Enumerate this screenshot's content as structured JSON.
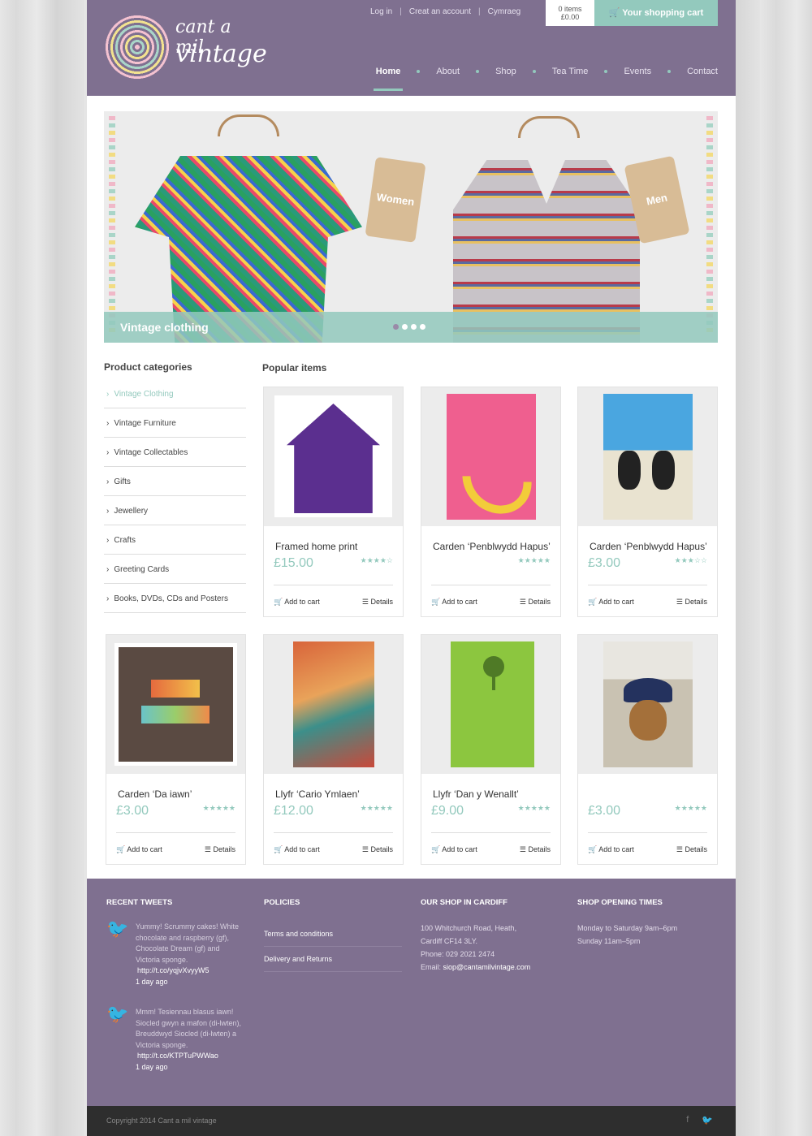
{
  "header": {
    "logo_line1": "cant a mil",
    "logo_line2": "vintage",
    "top_links": [
      "Log in",
      "Creat an account",
      "Cymraeg"
    ],
    "cart_items": "0 items",
    "cart_total": "£0.00",
    "cart_button": "Your shopping cart",
    "nav": [
      "Home",
      "About",
      "Shop",
      "Tea Time",
      "Events",
      "Contact"
    ]
  },
  "slider": {
    "tag_women": "Women",
    "tag_men": "Men",
    "caption": "Vintage clothing",
    "slide_count": 4,
    "active_slide": 1
  },
  "sidebar": {
    "title": "Product categories",
    "categories": [
      "Vintage Clothing",
      "Vintage Furniture",
      "Vintage Collectables",
      "Gifts",
      "Jewellery",
      "Crafts",
      "Greeting Cards",
      "Books, DVDs, CDs and Posters"
    ]
  },
  "popular": {
    "title": "Popular items",
    "add_label": "Add to cart",
    "details_label": "Details",
    "products": [
      {
        "name": "Framed home print",
        "price": "£15.00",
        "rating": 4
      },
      {
        "name": "Carden ‘Penblwydd Hapus’",
        "price": "",
        "rating": 5
      },
      {
        "name": "Carden ‘Penblwydd Hapus’",
        "price": "£3.00",
        "rating": 3
      },
      {
        "name": "Carden ‘Da iawn’",
        "price": "£3.00",
        "rating": 5
      },
      {
        "name": "Llyfr ‘Cario Ymlaen’",
        "price": "£12.00",
        "rating": 5
      },
      {
        "name": "Llyfr ‘Dan y Wenallt’",
        "price": "£9.00",
        "rating": 5
      },
      {
        "name": "",
        "price": "£3.00",
        "rating": 5
      }
    ]
  },
  "footer": {
    "tweets_title": "RECENT TWEETS",
    "tweets": [
      {
        "text": "Yummy! Scrummy cakes! White chocolate and raspberry (gf), Chocolate Dream (gf) and Victoria sponge.",
        "url": "http://t.co/yqjvXvyyW5",
        "ago": "1 day ago"
      },
      {
        "text": "Mmm! Tesiennau blasus iawn! Siocled gwyn a mafon (di-lwten), Breuddwyd Siocled (di-lwten) a Victoria sponge.",
        "url": "http://t.co/KTPTuPWWao",
        "ago": "1 day ago"
      }
    ],
    "policies_title": "POLICIES",
    "policies": [
      "Terms and conditions",
      "Delivery and Returns"
    ],
    "shop_title": "OUR SHOP IN CARDIFF",
    "shop_lines": [
      "100 Whitchurch Road, Heath,",
      "Cardiff CF14 3LY.",
      "Phone: 029 2021 2474"
    ],
    "shop_email_label": "Email:",
    "shop_email": "siop@cantamilvintage.com",
    "hours_title": "SHOP OPENING TIMES",
    "hours": [
      "Monday to Saturday 9am–6pm",
      "Sunday 11am–5pm"
    ],
    "copyright": "Copyright 2014 Cant a mil vintage"
  },
  "colors": {
    "purple": "#7f7090",
    "mint": "#93c9bd",
    "dark": "#2e2e2e"
  }
}
